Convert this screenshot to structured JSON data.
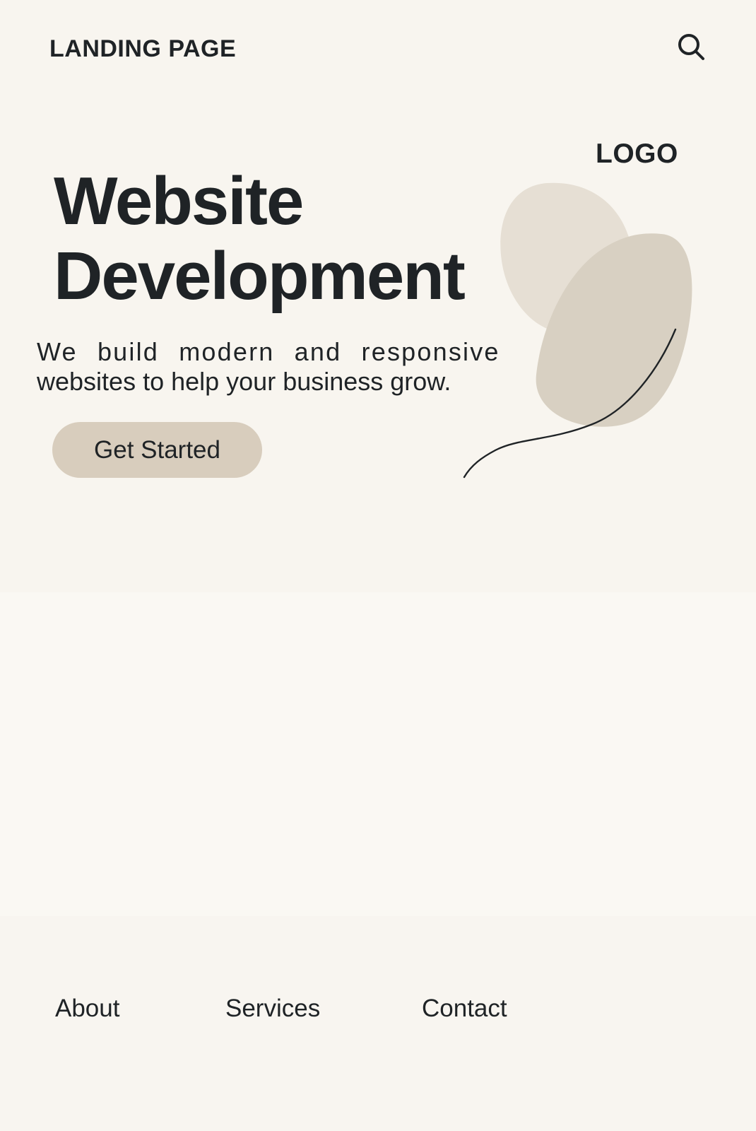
{
  "header": {
    "brand": "LANDING PAGE",
    "search_icon": "search-icon"
  },
  "hero": {
    "logo": "LOGO",
    "title_lines": [
      "Website",
      "Development"
    ],
    "description_lines": [
      "We build modern and responsive",
      "websites to help your business grow."
    ],
    "cta_label": "Get Started",
    "decoration_icon": "leaf-icon"
  },
  "footer": {
    "links": [
      {
        "label": "About"
      },
      {
        "label": "Services"
      },
      {
        "label": "Contact"
      }
    ]
  },
  "colors": {
    "background": "#f8f6f1",
    "text": "#1f2326",
    "button": "#d8cdbd",
    "leaf_light": "#e6dfd4",
    "leaf_dark": "#d8d0c2"
  }
}
